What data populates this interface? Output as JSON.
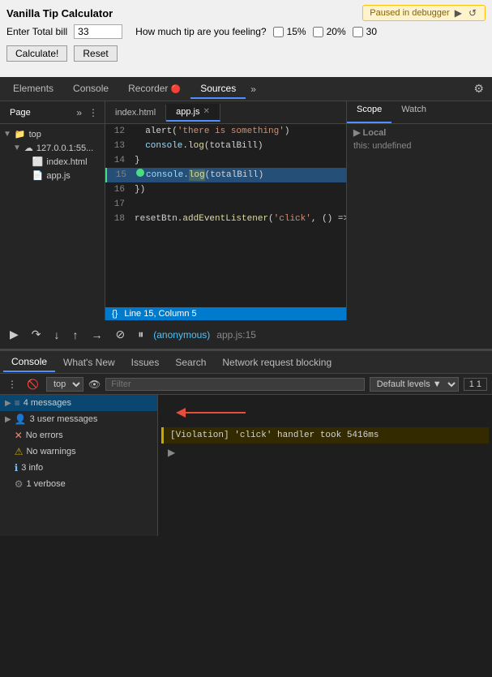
{
  "preview": {
    "title": "Vanilla Tip Calculator",
    "bill_label": "Enter Total bill",
    "bill_value": "33",
    "tip_label": "How much tip are you feeling?",
    "checkbox_15": "15%",
    "checkbox_20": "20%",
    "checkbox_30": "30",
    "calculate_label": "Calculate!",
    "reset_label": "Reset",
    "paused_label": "Paused in debugger"
  },
  "devtools": {
    "tabs": [
      {
        "label": "Elements",
        "active": false
      },
      {
        "label": "Console",
        "active": false
      },
      {
        "label": "Recorder",
        "active": false
      },
      {
        "label": "Sources",
        "active": true
      }
    ],
    "more_label": "»",
    "right_label": "⚙"
  },
  "sources": {
    "sidebar_tab_label": "Page",
    "tree": [
      {
        "level": 0,
        "icon": "▼",
        "label": "top",
        "type": "folder"
      },
      {
        "level": 1,
        "icon": "▼",
        "label": "127.0.0.1:55...",
        "type": "server"
      },
      {
        "level": 2,
        "icon": "",
        "label": "index.html",
        "type": "file"
      },
      {
        "level": 2,
        "icon": "",
        "label": "app.js",
        "type": "file"
      }
    ]
  },
  "editor": {
    "tabs": [
      {
        "label": "index.html",
        "active": false,
        "closable": false
      },
      {
        "label": "app.js",
        "active": true,
        "closable": true
      }
    ],
    "lines": [
      {
        "num": 12,
        "content": "  alert('there is something')",
        "paused": false,
        "highlighted": false
      },
      {
        "num": 13,
        "content": "  console.log(totalBill)",
        "paused": false,
        "highlighted": false
      },
      {
        "num": 14,
        "content": "}",
        "paused": false,
        "highlighted": false
      },
      {
        "num": 15,
        "content": "console.log(totalBill)",
        "paused": true,
        "highlighted": true,
        "has_bp": true
      },
      {
        "num": 16,
        "content": "})",
        "paused": false,
        "highlighted": false
      },
      {
        "num": 17,
        "content": "",
        "paused": false,
        "highlighted": false
      },
      {
        "num": 18,
        "content": "resetBtn.addEventListener('click', () => {",
        "paused": false,
        "highlighted": false
      }
    ],
    "status_bar": "Line 15, Column 5",
    "status_code": "{}"
  },
  "scope": {
    "tabs": [
      {
        "label": "Scope",
        "active": true
      },
      {
        "label": "Watch",
        "active": false
      }
    ],
    "local_label": "▶ Local",
    "this_label": "this: undefined"
  },
  "debugger": {
    "callstack": "(anonymous)",
    "location": "app.js:15"
  },
  "console": {
    "tabs": [
      {
        "label": "Console",
        "active": true
      },
      {
        "label": "What's New",
        "active": false
      },
      {
        "label": "Issues",
        "active": false
      },
      {
        "label": "Search",
        "active": false
      },
      {
        "label": "Network request blocking",
        "active": false
      }
    ],
    "top_label": "top",
    "filter_placeholder": "Filter",
    "default_levels_label": "Default levels ▼",
    "msg_count": "1 1",
    "sidebar_groups": [
      {
        "label": "4 messages",
        "icon": "≡",
        "icon_type": "messages"
      },
      {
        "label": "3 user messages",
        "icon": "👤",
        "icon_type": "user"
      },
      {
        "label": "No errors",
        "icon": "✕",
        "icon_type": "error"
      },
      {
        "label": "No warnings",
        "icon": "⚠",
        "icon_type": "warning"
      },
      {
        "label": "3 info",
        "icon": "ℹ",
        "icon_type": "info"
      },
      {
        "label": "1 verbose",
        "icon": "⚙",
        "icon_type": "verbose"
      }
    ],
    "violation_msg": "[Violation] 'click' handler took 5416ms",
    "expand_icon": "▶"
  }
}
